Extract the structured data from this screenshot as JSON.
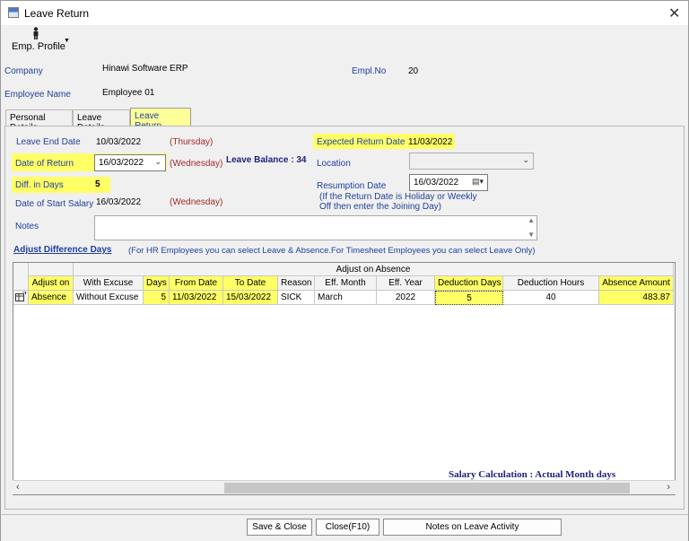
{
  "window": {
    "title": "Leave Return",
    "close": "✕"
  },
  "toolbar": {
    "emp_profile": "Emp. Profile"
  },
  "header": {
    "company_label": "Company",
    "company_value": "Hinawi Software ERP",
    "emplno_label": "Empl.No",
    "emplno_value": "20",
    "employee_label": "Employee Name",
    "employee_value": "Employee 01"
  },
  "tabs": [
    "Personal Details",
    "Leave Details",
    "Leave Return"
  ],
  "form": {
    "leave_end_label": "Leave End Date",
    "leave_end_value": "10/03/2022",
    "leave_end_day": "(Thursday)",
    "expected_return_label": "Expected Return Date",
    "expected_return_value": "11/03/2022",
    "date_of_return_label": "Date of Return",
    "date_of_return_value": "16/03/2022",
    "date_of_return_day": "(Wednesday)",
    "leave_balance": "Leave Balance : 34",
    "location_label": "Location",
    "location_value": "",
    "diff_label": "Diff. in Days",
    "diff_value": "5",
    "resumption_label": "Resumption Date",
    "resumption_value": "16/03/2022",
    "resumption_note": "(If the Return Date is Holiday or Weekly Off then enter the Joining Day)",
    "start_salary_label": "Date of Start Salary",
    "start_salary_value": "16/03/2022",
    "start_salary_day": "(Wednesday)",
    "notes_label": "Notes",
    "notes_value": ""
  },
  "adjust": {
    "link": "Adjust Difference Days",
    "hint": "(For HR Employees you can select Leave & Absence.For Timesheet Employees you can select Leave Only)"
  },
  "grid": {
    "group_header": "Adjust on Absence",
    "columns": [
      "Adjust on",
      "With Excuse",
      "Days",
      "From Date",
      "To Date",
      "Reason",
      "Eff. Month",
      "Eff. Year",
      "Deduction Days",
      "Deduction Hours",
      "Absence Amount"
    ],
    "rows": [
      [
        "Absence",
        "Without Excuse",
        "5",
        "11/03/2022",
        "15/03/2022",
        "SICK",
        "March",
        "2022",
        "5",
        "40",
        "483.87"
      ]
    ]
  },
  "salary_note": "Salary Calculation : Actual Month days",
  "buttons": {
    "save_close": "Save & Close",
    "close": "Close(F10)",
    "notes_activity": "Notes on Leave Activity"
  },
  "colors": {
    "highlight": "#ffff66",
    "label_blue": "#1f3f9e",
    "day_red": "#a52a2a"
  }
}
